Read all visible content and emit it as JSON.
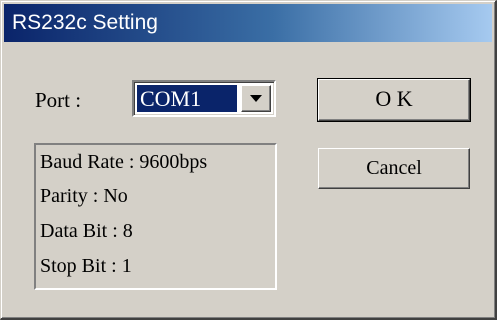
{
  "window": {
    "title": "RS232c Setting"
  },
  "port": {
    "label": "Port :",
    "selected": "COM1"
  },
  "info": [
    "Baud Rate : 9600bps",
    "Parity : No",
    "Data Bit : 8",
    "Stop Bit : 1"
  ],
  "buttons": {
    "ok": "O K",
    "cancel": "Cancel"
  },
  "colors": {
    "title_gradient_start": "#0a246a",
    "title_gradient_end": "#a6caf0",
    "dialog_face": "#d4d0c8",
    "selection": "#0a246a"
  },
  "icons": {
    "combo_arrow": "chevron-down-icon"
  }
}
